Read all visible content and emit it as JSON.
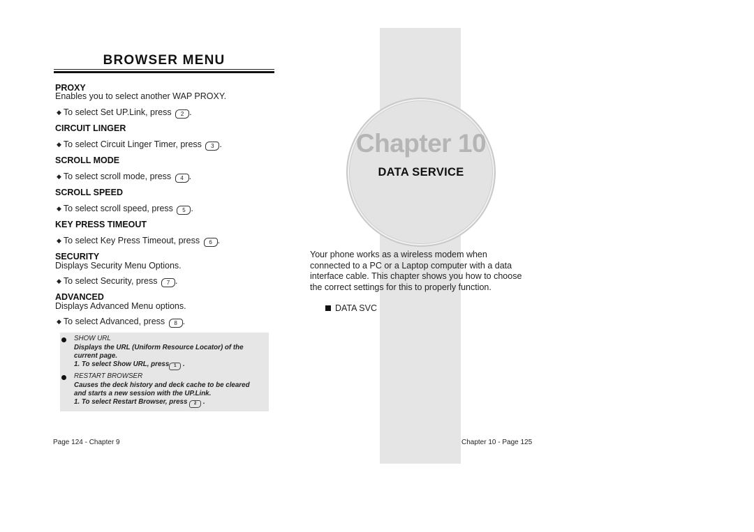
{
  "left_page": {
    "title": "BROWSER MENU",
    "sections": [
      {
        "heading": "PROXY",
        "description": "Enables you to select another WAP PROXY.",
        "instruction": "To select Set UP.Link, press",
        "key": "2ABC"
      },
      {
        "heading": "CIRCUIT LINGER",
        "instruction": "To select Circuit Linger Timer, press",
        "key": "3DEF"
      },
      {
        "heading": "SCROLL MODE",
        "instruction": "To select scroll mode, press",
        "key": "4GHI"
      },
      {
        "heading": "SCROLL SPEED",
        "instruction": "To select scroll speed, press",
        "key": "5JKL"
      },
      {
        "heading": "KEY PRESS TIMEOUT",
        "instruction": "To select Key Press Timeout, press",
        "key": "6MNO"
      },
      {
        "heading": "SECURITY",
        "description": "Displays Security Menu Options.",
        "instruction": "To select Security, press",
        "key": "7PQRS"
      },
      {
        "heading": "ADVANCED",
        "description": "Displays Advanced Menu options.",
        "instruction": "To select Advanced, press",
        "key": "8TUV"
      }
    ],
    "key_labels": {
      "2": "2",
      "3": "3",
      "4": "4",
      "5": "5",
      "6": "6",
      "7": "7",
      "8": "8"
    },
    "note_box": {
      "items": [
        {
          "heading": "SHOW URL",
          "text_line1": "Displays the URL (Uniform Resource Locator) of the",
          "text_line2": "current page.",
          "step": "1. To select Show URL, press",
          "key": "1"
        },
        {
          "heading": "RESTART BROWSER",
          "text_line1": "Causes the deck history and deck cache to be cleared",
          "text_line2": "and starts a new session with the UP.Link.",
          "step": "1. To select Restart Browser, press",
          "key": "2"
        }
      ]
    },
    "footer": "Page 124 - Chapter 9"
  },
  "right_page": {
    "chapter_label": "Chapter 10",
    "chapter_title": "DATA SERVICE",
    "intro_lines": [
      "Your phone works as a wireless modem when",
      "connected to a PC or a Laptop computer with a data",
      "interface cable. This chapter shows you how to choose",
      "the correct settings for this to properly function."
    ],
    "menu_item": "DATA SVC",
    "footer": "Chapter 10 - Page 125"
  },
  "colors": {
    "band": "#e5e5e5",
    "note_box": "#e6e6e6",
    "chapter_label": "#b5b5b5",
    "text": "#222222"
  }
}
